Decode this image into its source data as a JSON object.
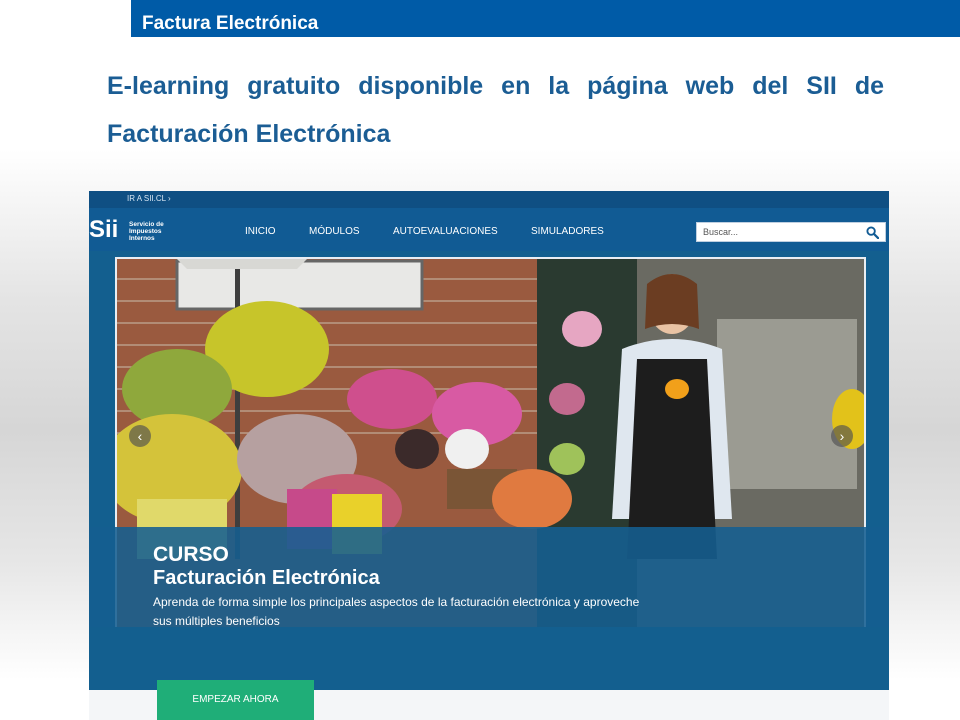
{
  "slide": {
    "header_title": "Factura Electrónica",
    "heading": "E-learning gratuito disponible en la página web del SII de Facturación Electrónica"
  },
  "site": {
    "ir_link": "IR A SII.CL ›",
    "logo_mark": "Sii",
    "logo_text": "Servicio de Impuestos Internos",
    "nav": [
      "INICIO",
      "MÓDULOS",
      "AUTOEVALUACIONES",
      "SIMULADORES"
    ],
    "search_placeholder": "Buscar...",
    "hero": {
      "prev_arrow": "‹",
      "next_arrow": "›"
    },
    "banner": {
      "kicker": "CURSO",
      "title": "Facturación Electrónica",
      "text": "Aprenda de forma simple los principales aspectos de la facturación electrónica y aproveche sus múltiples beneficios"
    },
    "cta_label": "EMPEZAR AHORA"
  },
  "colors": {
    "header_blue": "#005ba7",
    "heading_blue": "#1b5d94",
    "nav_blue": "#115b94",
    "cta_green": "#1fae78"
  }
}
